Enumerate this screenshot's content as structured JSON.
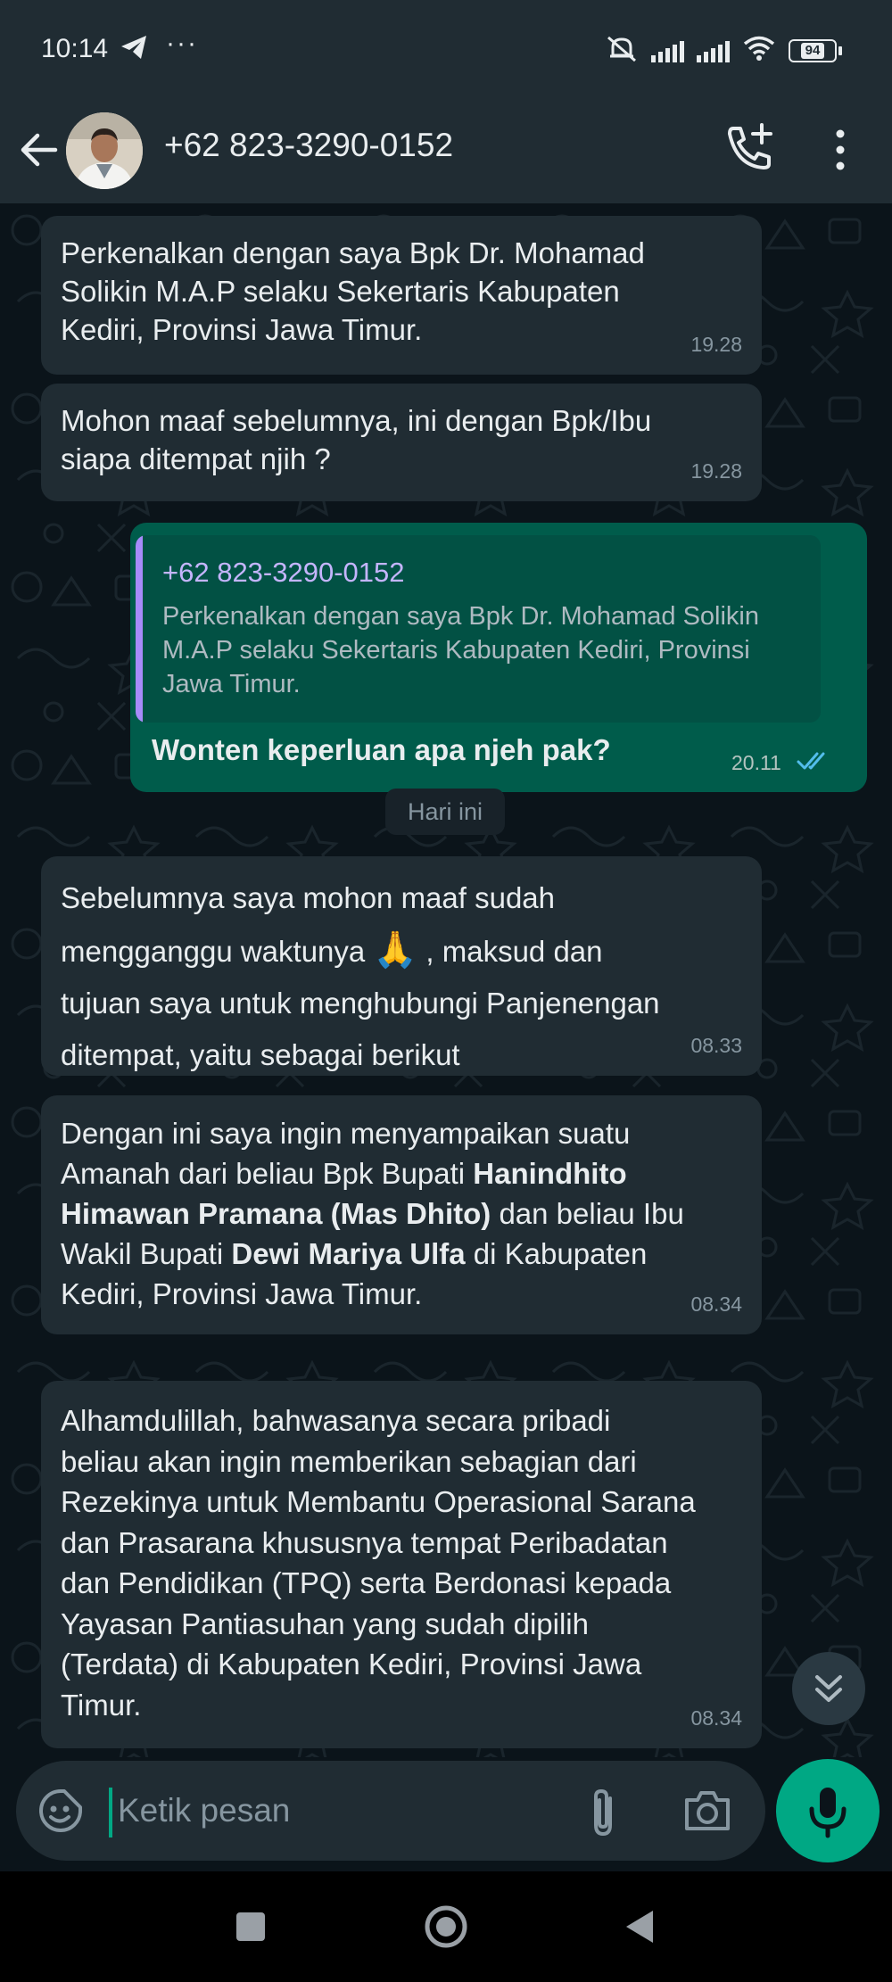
{
  "status_bar": {
    "time": "10:14",
    "more": "···",
    "battery": "94"
  },
  "header": {
    "contact_name": "+62 823-3290-0152"
  },
  "messages": [
    {
      "direction": "in",
      "text": "Perkenalkan dengan saya Bpk Dr. Mohamad\nSolikin M.A.P selaku Sekertaris Kabupaten\nKediri, Provinsi Jawa Timur.",
      "time": "19.28"
    },
    {
      "direction": "in",
      "text": "Mohon maaf sebelumnya, ini dengan Bpk/Ibu\nsiapa ditempat njih ?",
      "time": "19.28"
    },
    {
      "direction": "out",
      "quote_name": "+62 823-3290-0152",
      "quote_text": "Perkenalkan dengan saya Bpk Dr. Mohamad Solikin M.A.P selaku Sekertaris Kabupaten Kediri, Provinsi Jawa Timur.",
      "text": "Wonten keperluan apa njeh pak?",
      "time": "20.11"
    },
    {
      "direction": "in",
      "text_before": "Sebelumnya saya mohon maaf sudah\nmengganggu waktunya ",
      "emoji": "🙏",
      "text_after": " , maksud dan\ntujuan saya untuk menghubungi Panjenengan\nditempat, yaitu sebagai berikut",
      "time": "08.33"
    },
    {
      "direction": "in",
      "t1": "Dengan ini saya ingin menyampaikan suatu\nAmanah dari beliau Bpk Bupati ",
      "b1": "Hanindhito\nHimawan Pramana (Mas Dhito)",
      "t2": " dan beliau Ibu\nWakil Bupati ",
      "b2": "Dewi Mariya Ulfa",
      "t3": " di Kabupaten\nKediri, Provinsi Jawa Timur.",
      "time": "08.34"
    },
    {
      "direction": "in",
      "text": "Alhamdulillah, bahwasanya secara pribadi\nbeliau akan ingin memberikan sebagian dari\nRezekinya untuk Membantu Operasional Sarana\ndan Prasarana khususnya tempat Peribadatan\ndan Pendidikan (TPQ) serta Berdonasi kepada\nYayasan Pantiasuhan yang sudah dipilih\n(Terdata) di Kabupaten Kediri, Provinsi Jawa\nTimur.",
      "time": "08.34"
    }
  ],
  "date_separator": "Hari ini",
  "input": {
    "placeholder": "Ketik pesan",
    "value": ""
  },
  "colors": {
    "background": "#0b141a",
    "bar": "#202c33",
    "incoming_bubble": "#202c33",
    "outgoing_bubble": "#005c4b",
    "accent": "#00a884",
    "read_ticks": "#53bdeb",
    "quote_name": "#c4b5fd"
  },
  "icons": {
    "back": "back-arrow-icon",
    "call_add": "call-add-icon",
    "menu": "kebab-menu-icon",
    "emoji": "emoji-icon",
    "attach": "paperclip-icon",
    "camera": "camera-icon",
    "mic": "microphone-icon",
    "scroll_down": "double-chevron-down-icon"
  }
}
